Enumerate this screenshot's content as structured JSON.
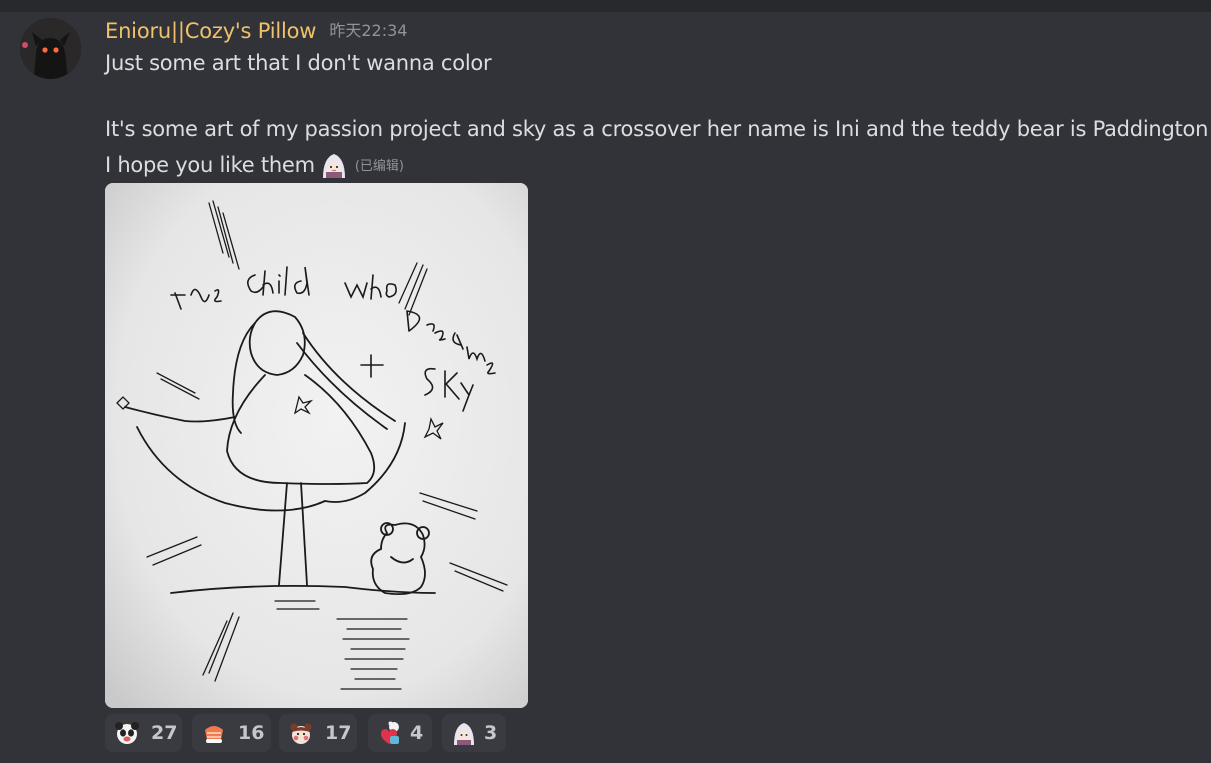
{
  "message": {
    "author": "Enioru||Cozy's Pillow",
    "timestamp": "昨天22:34",
    "lines": [
      "Just some art that I don't wanna color",
      "It's some art of my passion project and sky as a crossover her name is Ini and the teddy bear is Paddington!!",
      "I hope you like them"
    ],
    "edited_label": "(已编辑)",
    "inline_emoji": "girl-emoji",
    "username_color": "#f0c06a"
  },
  "attachment": {
    "drawing_text": [
      "The",
      "child",
      "who",
      "Dreams",
      "+",
      "Sky"
    ]
  },
  "reactions": [
    {
      "emoji": "panda-reaction-icon",
      "count": "27"
    },
    {
      "emoji": "sushi-reaction-icon",
      "count": "16"
    },
    {
      "emoji": "bear-cheeks-reaction-icon",
      "count": "17"
    },
    {
      "emoji": "heart-bear-reaction-icon",
      "count": "4"
    },
    {
      "emoji": "girl-reaction-icon",
      "count": "3"
    }
  ]
}
